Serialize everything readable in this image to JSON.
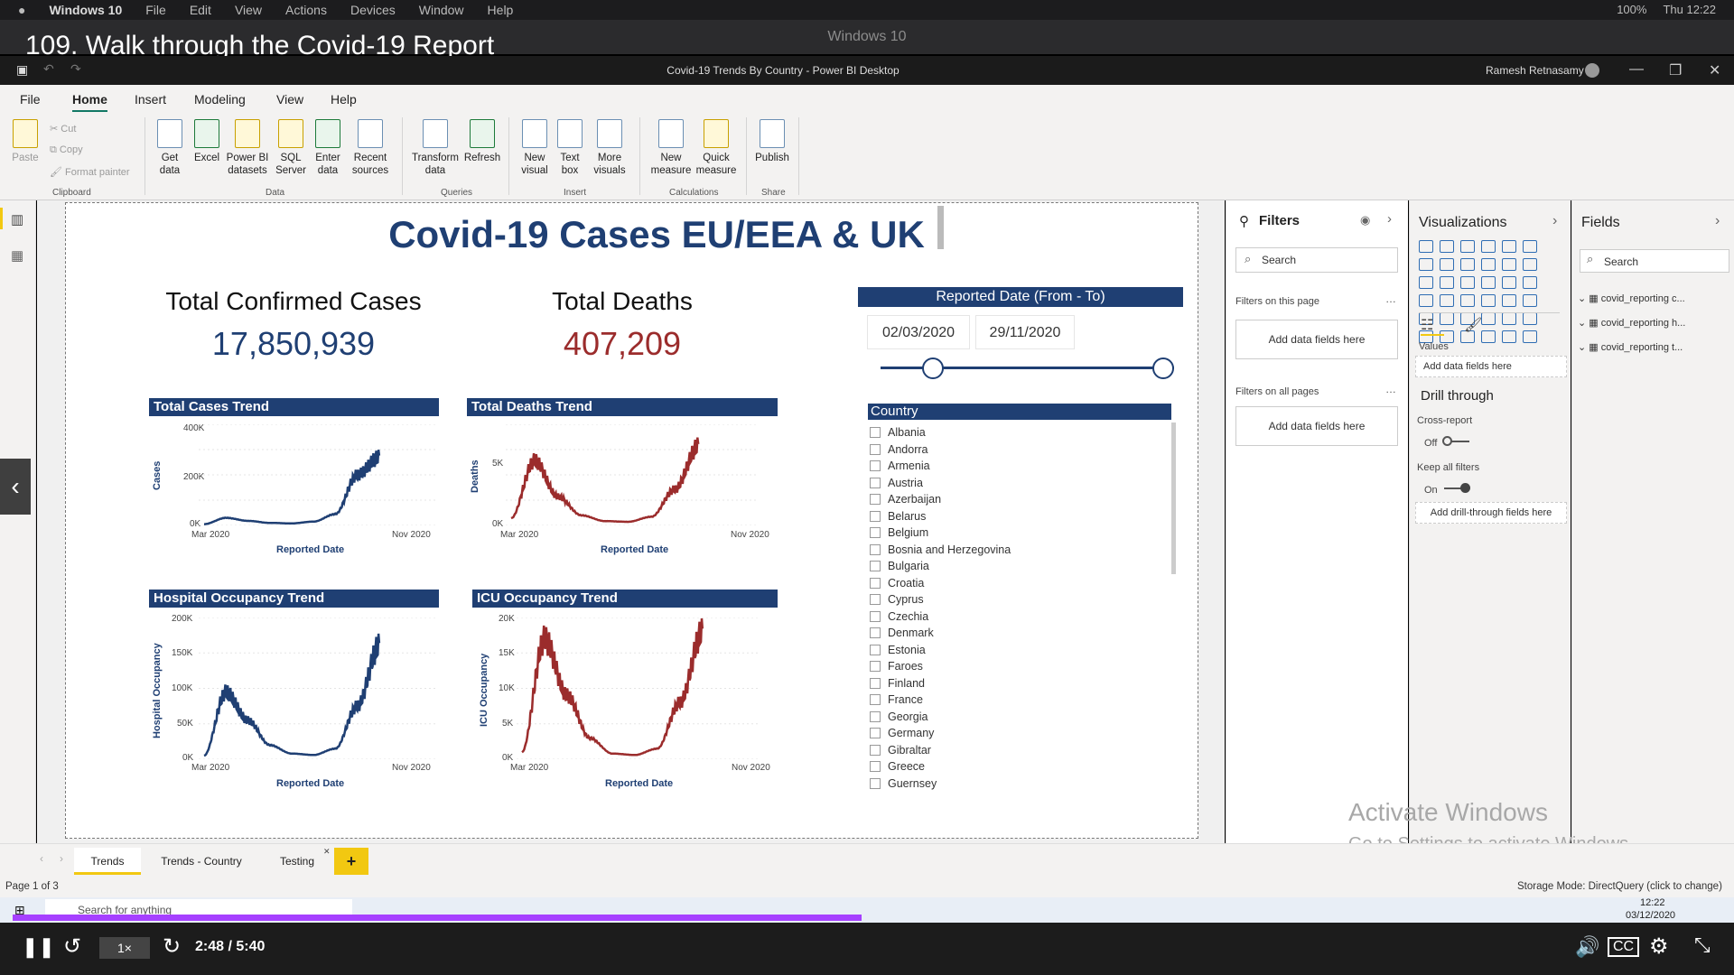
{
  "mac_menu": {
    "apple": "",
    "app": "Windows 10",
    "items": [
      "File",
      "Edit",
      "View",
      "Actions",
      "Devices",
      "Window",
      "Help"
    ],
    "status": "100%",
    "clock": "Thu 12:22"
  },
  "vm_title": "Windows 10",
  "lecture_title": "109. Walk through the Covid-19 Report",
  "pbi": {
    "title": "Covid-19 Trends By Country - Power BI Desktop",
    "user": "Ramesh Retnasamy"
  },
  "ribbon": {
    "tabs": [
      "File",
      "Home",
      "Insert",
      "Modeling",
      "View",
      "Help"
    ],
    "clipboard": {
      "paste": "Paste",
      "cut": "Cut",
      "copy": "Copy",
      "format": "Format painter",
      "group": "Clipboard"
    },
    "data": {
      "get": "Get data",
      "excel": "Excel",
      "pbids": "Power BI datasets",
      "sql": "SQL Server",
      "enter": "Enter data",
      "recent": "Recent sources",
      "group": "Data"
    },
    "queries": {
      "transform": "Transform data",
      "refresh": "Refresh",
      "group": "Queries"
    },
    "insert": {
      "newvisual": "New visual",
      "textbox": "Text box",
      "more": "More visuals",
      "group": "Insert"
    },
    "calc": {
      "measure": "New measure",
      "quick": "Quick measure",
      "group": "Calculations"
    },
    "share": {
      "publish": "Publish",
      "group": "Share"
    }
  },
  "report": {
    "title": "Covid-19 Cases EU/EEA & UK",
    "kpi1": {
      "label": "Total Confirmed Cases",
      "value": "17,850,939"
    },
    "kpi2": {
      "label": "Total Deaths",
      "value": "407,209"
    },
    "slicer": {
      "title": "Reported Date (From - To)",
      "from": "02/03/2020",
      "to": "29/11/2020",
      "range_fraction": [
        0.0,
        1.0
      ]
    },
    "country_header": "Country",
    "countries": [
      "Albania",
      "Andorra",
      "Armenia",
      "Austria",
      "Azerbaijan",
      "Belarus",
      "Belgium",
      "Bosnia and Herzegovina",
      "Bulgaria",
      "Croatia",
      "Cyprus",
      "Czechia",
      "Denmark",
      "Estonia",
      "Faroes",
      "Finland",
      "France",
      "Georgia",
      "Germany",
      "Gibraltar",
      "Greece",
      "Guernsey"
    ]
  },
  "charts": {
    "c1": {
      "title": "Total Cases Trend",
      "ylabel": "Cases",
      "xlabel": "Reported Date",
      "yticks": [
        "400K",
        "200K",
        "0K"
      ],
      "xticks": [
        "Mar 2020",
        "Nov 2020"
      ],
      "color": "#1f3f73"
    },
    "c2": {
      "title": "Total Deaths Trend",
      "ylabel": "Deaths",
      "xlabel": "Reported Date",
      "yticks": [
        "5K",
        "0K"
      ],
      "xticks": [
        "Mar 2020",
        "Nov 2020"
      ],
      "color": "#9b2c2c"
    },
    "c3": {
      "title": "Hospital Occupancy Trend",
      "ylabel": "Hospital Occupancy",
      "xlabel": "Reported Date",
      "yticks": [
        "200K",
        "150K",
        "100K",
        "50K",
        "0K"
      ],
      "xticks": [
        "Mar 2020",
        "Nov 2020"
      ],
      "color": "#1f3f73"
    },
    "c4": {
      "title": "ICU Occupancy Trend",
      "ylabel": "ICU Occupancy",
      "xlabel": "Reported Date",
      "yticks": [
        "20K",
        "15K",
        "10K",
        "5K",
        "0K"
      ],
      "xticks": [
        "Mar 2020",
        "Nov 2020"
      ],
      "color": "#9b2c2c"
    }
  },
  "chart_data": [
    {
      "type": "line",
      "title": "Total Cases Trend",
      "xlabel": "Reported Date",
      "ylabel": "Cases",
      "ylim": [
        0,
        400000
      ],
      "x": [
        "Mar 2020",
        "Apr 2020",
        "May 2020",
        "Jun 2020",
        "Jul 2020",
        "Aug 2020",
        "Sep 2020",
        "Oct 2020",
        "Nov 2020"
      ],
      "series": [
        {
          "values": [
            5000,
            30000,
            18000,
            10000,
            8000,
            15000,
            45000,
            200000,
            270000
          ]
        }
      ]
    },
    {
      "type": "line",
      "title": "Total Deaths Trend",
      "xlabel": "Reported Date",
      "ylabel": "Deaths",
      "ylim": [
        0,
        7000
      ],
      "x": [
        "Mar 2020",
        "Apr 2020",
        "May 2020",
        "Jun 2020",
        "Jul 2020",
        "Aug 2020",
        "Sep 2020",
        "Oct 2020",
        "Nov 2020"
      ],
      "series": [
        {
          "values": [
            500,
            4500,
            2000,
            700,
            300,
            250,
            600,
            2500,
            5500
          ]
        }
      ]
    },
    {
      "type": "line",
      "title": "Hospital Occupancy Trend",
      "xlabel": "Reported Date",
      "ylabel": "Hospital Occupancy",
      "ylim": [
        0,
        200000
      ],
      "x": [
        "Mar 2020",
        "Apr 2020",
        "May 2020",
        "Jun 2020",
        "Jul 2020",
        "Aug 2020",
        "Sep 2020",
        "Oct 2020",
        "Nov 2020"
      ],
      "series": [
        {
          "values": [
            5000,
            95000,
            55000,
            20000,
            8000,
            6000,
            15000,
            75000,
            160000
          ]
        }
      ]
    },
    {
      "type": "line",
      "title": "ICU Occupancy Trend",
      "xlabel": "Reported Date",
      "ylabel": "ICU Occupancy",
      "ylim": [
        0,
        20000
      ],
      "x": [
        "Mar 2020",
        "Apr 2020",
        "May 2020",
        "Jun 2020",
        "Jul 2020",
        "Aug 2020",
        "Sep 2020",
        "Oct 2020",
        "Nov 2020"
      ],
      "series": [
        {
          "values": [
            1000,
            17000,
            9000,
            3000,
            800,
            600,
            1500,
            8000,
            18000
          ]
        }
      ]
    }
  ],
  "filters": {
    "title": "Filters",
    "search": "Search",
    "on_page": "Filters on this page",
    "add": "Add data fields here",
    "on_all": "Filters on all pages",
    "add2": "Add data fields here"
  },
  "viz": {
    "title": "Visualizations",
    "values": "Values",
    "add_values": "Add data fields here",
    "drill": "Drill through",
    "cross": "Cross-report",
    "off": "Off",
    "keep": "Keep all filters",
    "on": "On",
    "add_drill": "Add drill-through fields here"
  },
  "fields": {
    "title": "Fields",
    "search": "Search",
    "tables": [
      "covid_reporting c...",
      "covid_reporting h...",
      "covid_reporting t..."
    ]
  },
  "pages": {
    "tabs": [
      "Trends",
      "Trends - Country",
      "Testing"
    ],
    "page": "Page 1 of 3",
    "storage": "Storage Mode: DirectQuery (click to change)"
  },
  "activate": {
    "line1": "Activate Windows",
    "line2": "Go to Settings to activate Windows."
  },
  "player": {
    "speed": "1×",
    "time": "2:48 / 5:40"
  },
  "taskbar": {
    "search": "Search for anything",
    "time": "12:22",
    "date": "03/12/2020"
  }
}
